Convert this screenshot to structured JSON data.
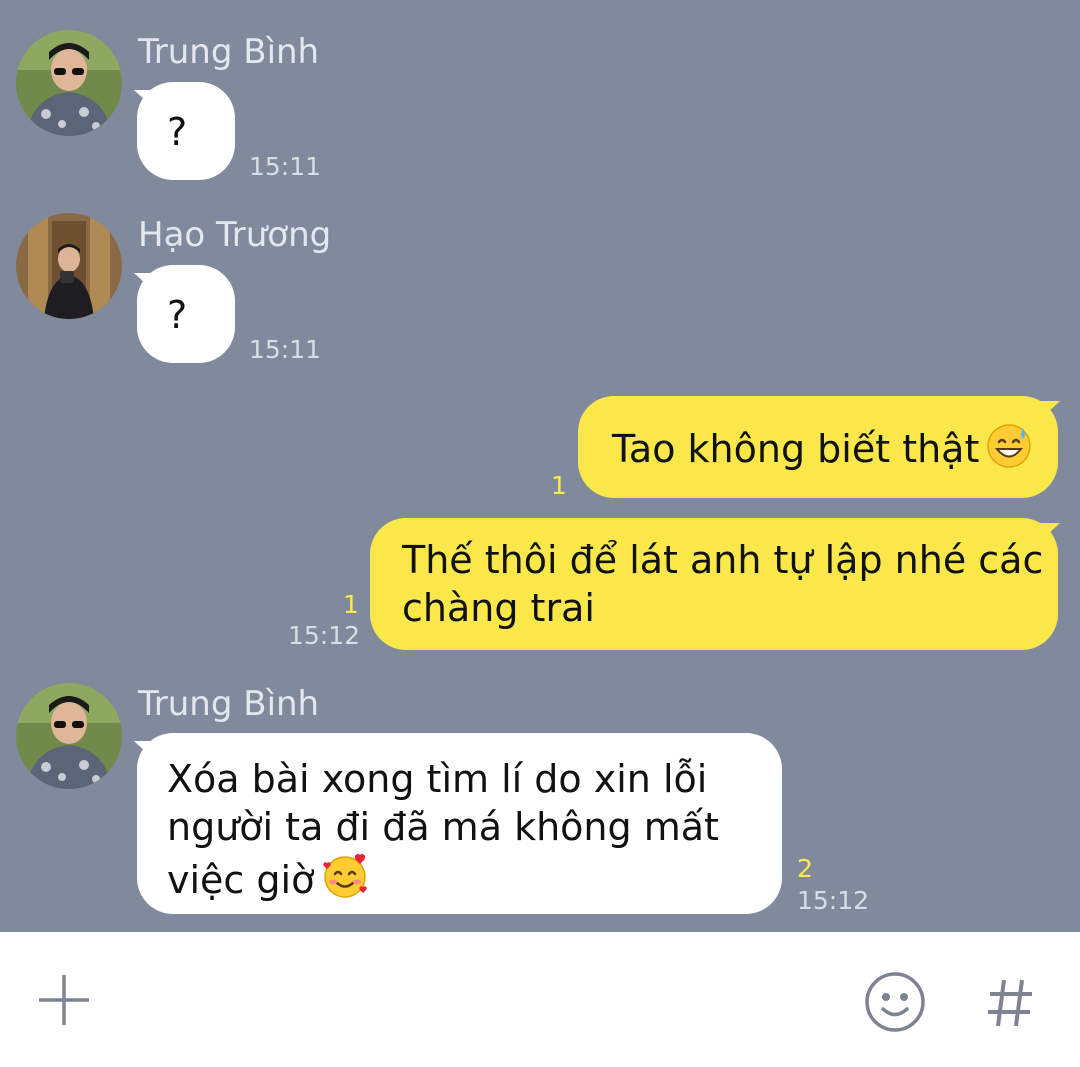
{
  "messages": [
    {
      "sender": "Trung Bình",
      "text": "?",
      "time": "15:11",
      "avatar": "avatar-trung-binh"
    },
    {
      "sender": "Hạo Trương",
      "text": "?",
      "time": "15:11",
      "avatar": "avatar-hao-truong"
    },
    {
      "sender": "me",
      "text": "Tao không biết thật",
      "emoji": "grinning-sweat-emoji",
      "unread": "1"
    },
    {
      "sender": "me",
      "lines": [
        "Thế thôi để lát anh tự lập nhé các",
        "chàng trai"
      ],
      "unread": "1",
      "time": "15:12"
    },
    {
      "sender": "Trung Bình",
      "lines": [
        "Xóa bài xong tìm lí do xin lỗi",
        "người ta đi đã má không mất",
        "việc giờ"
      ],
      "emoji": "smiling-hearts-emoji",
      "unread": "2",
      "time": "15:12",
      "avatar": "avatar-trung-binh"
    }
  ],
  "input_bar": {
    "icons": [
      "plus-icon",
      "smiley-icon",
      "hash-icon"
    ]
  },
  "colors": {
    "chat_background": "#808a9c",
    "outgoing_bubble": "#fae84a",
    "incoming_bubble": "#ffffff",
    "unread_count": "#ffe94a"
  }
}
